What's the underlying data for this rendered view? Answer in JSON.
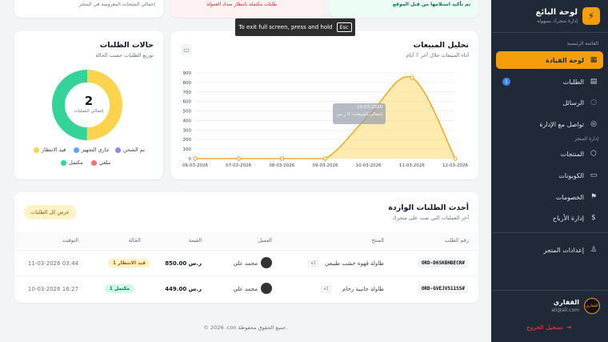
{
  "top_strip": {
    "right_text": "تم تأكيد استلامها من قبل الموقع",
    "middle_text": "طلبات مكتملة بانتظار سداد العمولة",
    "left_text": "إجمالي المنتجات المعروضة في المتجر"
  },
  "fullscreen_notice": {
    "text": "To exit full screen, press and hold",
    "key": "Esc"
  },
  "sidebar": {
    "brand_title": "لوحة البائع",
    "brand_subtitle": "إدارة متجرك بسهولة",
    "section_main": "القائمة الرئيسية",
    "section_store": "إدارة المتجر",
    "items": [
      {
        "label": "لوحة القيادة",
        "icon": "grid-icon",
        "glyph": "▦"
      },
      {
        "label": "الطلبات",
        "icon": "clipboard-icon",
        "glyph": "▤",
        "badge": "1"
      },
      {
        "label": "الرسائل",
        "icon": "chat-icon",
        "glyph": "◌"
      },
      {
        "label": "تواصل مع الإدارة",
        "icon": "headset-icon",
        "glyph": "◎"
      },
      {
        "label": "المنتجات",
        "icon": "box-icon",
        "glyph": "⬡"
      },
      {
        "label": "الكوبونات",
        "icon": "ticket-icon",
        "glyph": "▭"
      },
      {
        "label": "الخصومات",
        "icon": "tag-icon",
        "glyph": "⚑"
      },
      {
        "label": "إدارة الأرباح",
        "icon": "dollar-icon",
        "glyph": "$"
      },
      {
        "label": "إعدادات المتجر",
        "icon": "user-icon",
        "glyph": "♙"
      }
    ],
    "user": {
      "avatar_text": "القفاري",
      "name": "القفاري",
      "email": "ali@ali.com"
    },
    "logout": "تسجيل الخروج"
  },
  "sales": {
    "title": "تحليل المبيعات",
    "subtitle": "أداء المبيعات خلال آخر 7 أيام",
    "tooltip_date": "10-03-2026",
    "tooltip_value": "إجمالي المبيعات: 0 ر.س"
  },
  "chart_data": {
    "type": "area",
    "categories": [
      "06-03-2026",
      "07-03-2026",
      "08-03-2026",
      "09-03-2026",
      "10-03-2026",
      "11-03-2026",
      "12-03-2026"
    ],
    "values": [
      0,
      0,
      0,
      0,
      450,
      850,
      0
    ],
    "yticks": [
      0,
      100,
      200,
      300,
      400,
      500,
      600,
      700,
      800,
      900
    ],
    "ylim": [
      0,
      900
    ],
    "grid": true,
    "color": "#f59e0b"
  },
  "status": {
    "title": "حالات الطلبات",
    "subtitle": "توزيع الطلبات حسب الحالة",
    "total": "2",
    "total_label": "إجمالي العمليات",
    "legend": [
      {
        "label": "قيد الانتظار",
        "color": "#fcd34d"
      },
      {
        "label": "جاري التجهيز",
        "color": "#60a5fa"
      },
      {
        "label": "تم الشحن",
        "color": "#818cf8"
      },
      {
        "label": "ملغي",
        "color": "#f87171"
      },
      {
        "label": "مكتمل",
        "color": "#34d399"
      }
    ],
    "segments": [
      {
        "label": "قيد الانتظار",
        "value": 1,
        "color": "#fcd34d"
      },
      {
        "label": "مكتمل",
        "value": 1,
        "color": "#34d399"
      }
    ]
  },
  "orders": {
    "title": "أحدث الطلبات الواردة",
    "subtitle": "آخر العمليات التي تمت على متجرك",
    "view_all": "عرض كل الطلبات",
    "columns": [
      "رقم الطلب",
      "المنتج",
      "العميل",
      "القيمة",
      "الحالة",
      "التوقيت"
    ],
    "rows": [
      {
        "id": "ORD-D6SKBHBECR#",
        "product": "طاولة قهوة خشب طبيعي",
        "qty": "x1",
        "customer": "محمد علي",
        "amount": "850.00 ر.س",
        "status": "1 قيد الانتظار",
        "status_color": "#b45309",
        "status_bg": "#fef3c7",
        "time": "11-03-2026 03:44"
      },
      {
        "id": "ORD-GVEJV511SS#",
        "product": "طاولة جانبية رخام",
        "qty": "x1",
        "customer": "محمد علي",
        "amount": "449.00 ر.س",
        "status": "1 مكتمل",
        "status_color": "#047857",
        "status_bg": "#d1fae5",
        "time": "10-03-2026 16:27"
      }
    ]
  },
  "footer": "© 2026 .con جميع الحقوق محفوظة."
}
